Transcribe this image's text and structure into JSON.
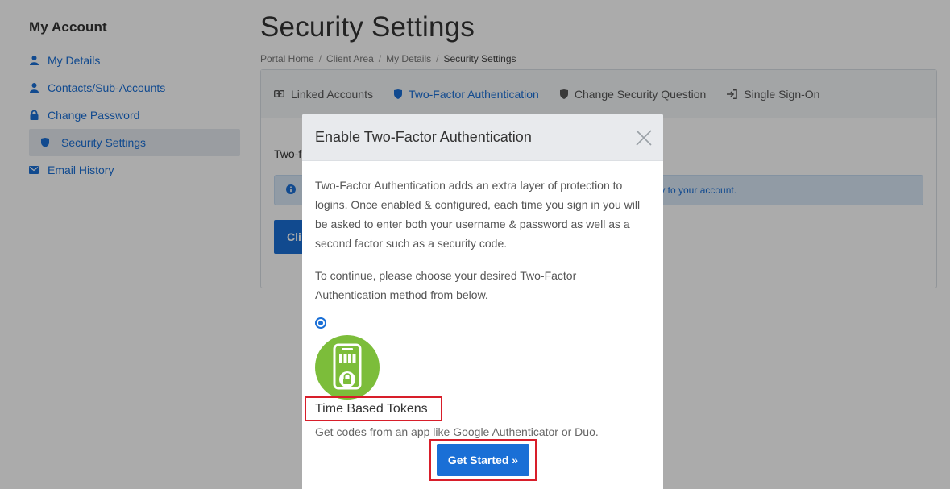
{
  "sidebar": {
    "heading": "My Account",
    "items": [
      {
        "label": "My Details",
        "icon": "user-icon"
      },
      {
        "label": "Contacts/Sub-Accounts",
        "icon": "user-icon"
      },
      {
        "label": "Change Password",
        "icon": "lock-icon"
      },
      {
        "label": "Security Settings",
        "icon": "shield-icon",
        "active": true
      },
      {
        "label": "Email History",
        "icon": "envelope-icon"
      }
    ]
  },
  "main": {
    "title": "Security Settings",
    "breadcrumb": [
      "Portal Home",
      "Client Area",
      "My Details",
      "Security Settings"
    ],
    "tabs": [
      {
        "label": "Linked Accounts",
        "icon": "link-icon"
      },
      {
        "label": "Two-Factor Authentication",
        "icon": "shield-icon",
        "active": true
      },
      {
        "label": "Change Security Question",
        "icon": "shield-icon"
      },
      {
        "label": "Single Sign-On",
        "icon": "sign-in-icon"
      }
    ],
    "body_text_partial": "Two-f",
    "info_text_partial": "ty to your account.",
    "button_partial": "Cli"
  },
  "modal": {
    "title": "Enable Two-Factor Authentication",
    "paragraph1": "Two-Factor Authentication adds an extra layer of protection to logins. Once enabled & configured, each time you sign in you will be asked to enter both your username & password as well as a second factor such as a security code.",
    "paragraph2": "To continue, please choose your desired Two-Factor Authentication method from below.",
    "method": {
      "title": "Time Based Tokens",
      "description": "Get codes from an app like Google Authenticator or Duo.",
      "selected": true
    },
    "get_started_label": "Get Started »"
  },
  "colors": {
    "accent": "#1a6fd6",
    "token_icon_bg": "#7cbd3a",
    "highlight_border": "#d81e2a"
  }
}
